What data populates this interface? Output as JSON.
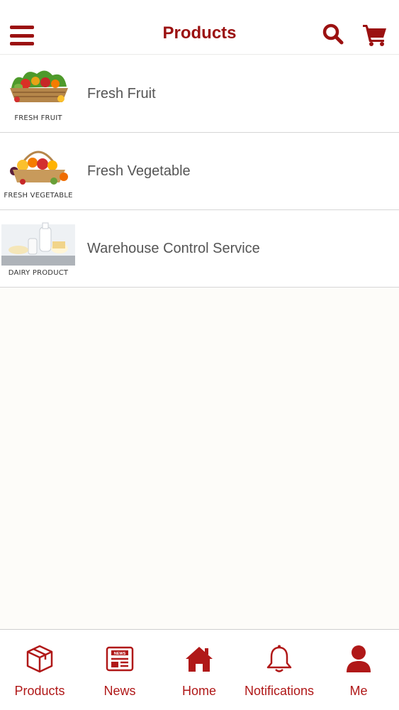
{
  "header": {
    "title": "Products",
    "menu_icon": "hamburger-menu-icon",
    "search_icon": "search-icon",
    "cart_icon": "shopping-cart-icon"
  },
  "categories": [
    {
      "label": "Fresh Fruit",
      "thumb_caption": "FRESH FRUIT"
    },
    {
      "label": "Fresh Vegetable",
      "thumb_caption": "FRESH VEGETABLE"
    },
    {
      "label": "Warehouse Control Service",
      "thumb_caption": "DAIRY PRODUCT"
    }
  ],
  "tabbar": {
    "tabs": [
      {
        "label": "Products",
        "icon": "box-icon"
      },
      {
        "label": "News",
        "icon": "newspaper-icon"
      },
      {
        "label": "Home",
        "icon": "home-icon"
      },
      {
        "label": "Notifications",
        "icon": "bell-icon"
      },
      {
        "label": "Me",
        "icon": "user-icon"
      }
    ],
    "news_icon_text": "NEWS"
  },
  "colors": {
    "brand": "#9b1111",
    "tab_label": "#b01818",
    "row_label": "#555555",
    "background": "#fdfcf9"
  }
}
